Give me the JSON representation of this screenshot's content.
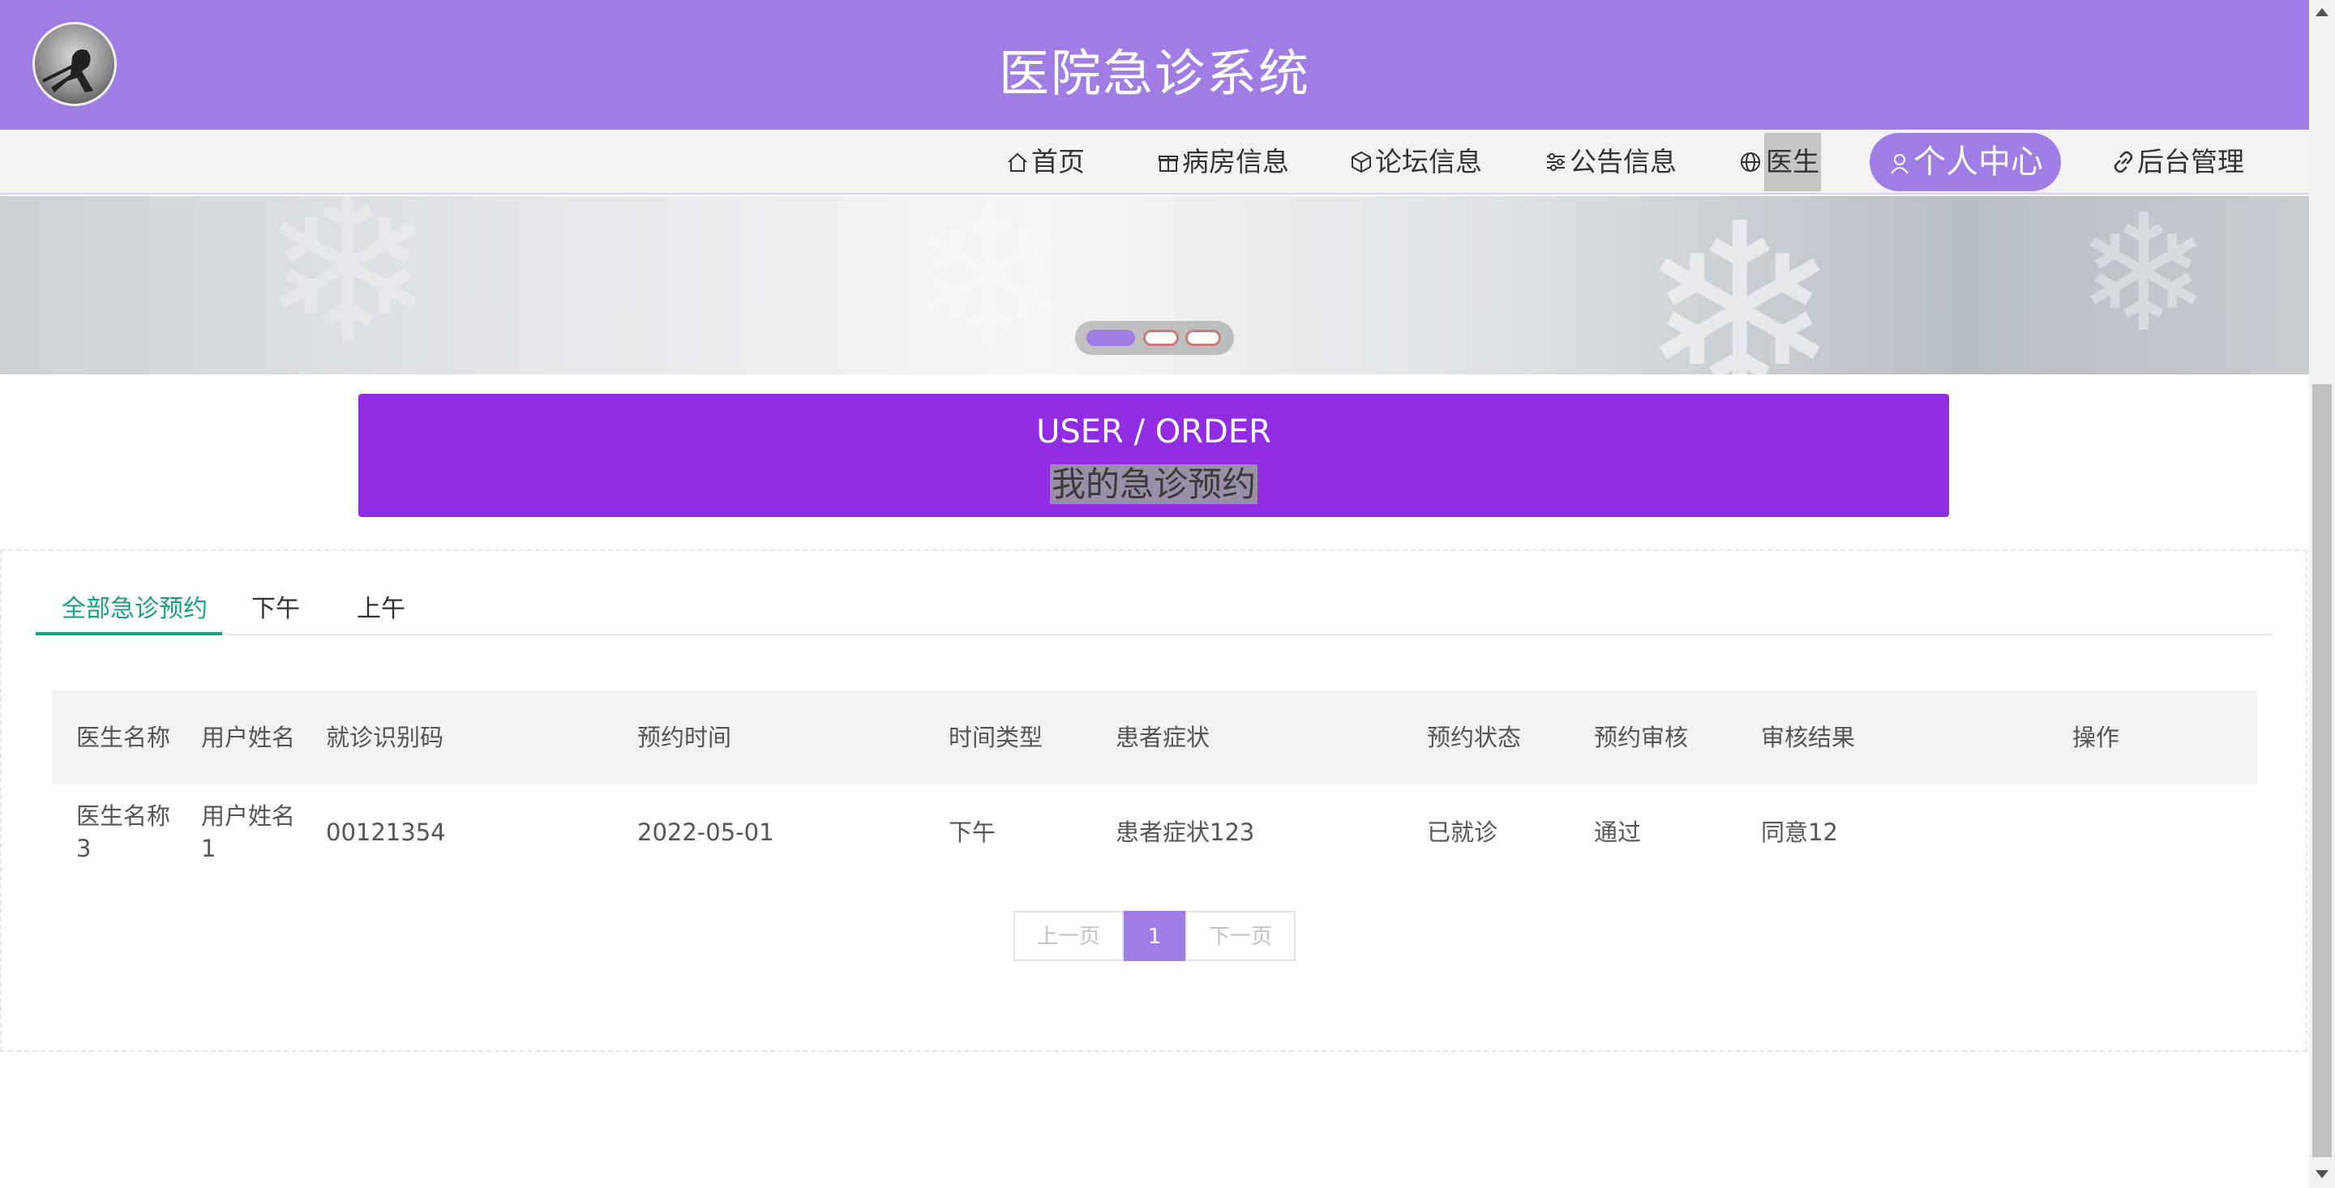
{
  "header": {
    "title": "医院急诊系统",
    "logo_icon": "avatar-logo"
  },
  "nav": {
    "items": [
      {
        "label": "首页",
        "icon": "home-icon"
      },
      {
        "label": "病房信息",
        "icon": "gift-icon"
      },
      {
        "label": "论坛信息",
        "icon": "cube-icon"
      },
      {
        "label": "公告信息",
        "icon": "sliders-icon"
      },
      {
        "label": "医生",
        "icon": "globe-icon"
      },
      {
        "label": "个人中心",
        "icon": "user-icon"
      },
      {
        "label": "后台管理",
        "icon": "link-icon"
      }
    ],
    "active_color": "#a07de4"
  },
  "banner": {
    "slides": 3,
    "active_slide": 1
  },
  "section": {
    "title_en": "USER / ORDER",
    "title_cn": "我的急诊预约",
    "accent": "#912ce3"
  },
  "tabs": [
    {
      "label": "全部急诊预约",
      "active": true
    },
    {
      "label": "下午"
    },
    {
      "label": "上午"
    }
  ],
  "table": {
    "headers": [
      "医生名称",
      "用户姓名",
      "就诊识别码",
      "预约时间",
      "时间类型",
      "患者症状",
      "预约状态",
      "预约审核",
      "审核结果",
      "操作"
    ],
    "rows": [
      [
        "医生名称3",
        "用户姓名1",
        "00121354",
        "2022-05-01",
        "下午",
        "患者症状123",
        "已就诊",
        "通过",
        "同意12",
        ""
      ]
    ]
  },
  "pager": {
    "prev": "上一页",
    "current": "1",
    "next": "下一页"
  },
  "colors": {
    "header_bg": "#a07de4",
    "tab_active": "#16a085"
  }
}
